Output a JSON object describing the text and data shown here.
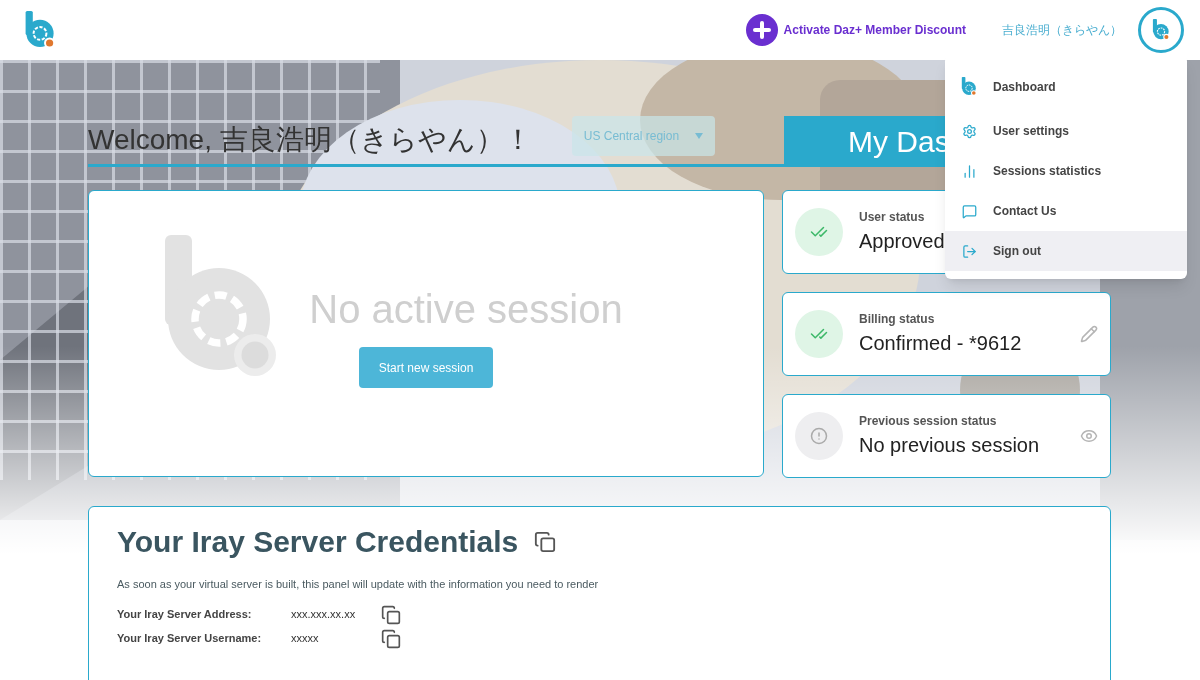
{
  "header": {
    "discount_link": "Activate Daz+ Member Discount",
    "user_name": "吉良浩明（きらやん）"
  },
  "welcome": "Welcome, 吉良浩明（きらやん）！",
  "region_select": {
    "value": "US Central region"
  },
  "dashboard_tab": "My Das",
  "session_panel": {
    "message": "No active session",
    "button": "Start new session"
  },
  "status_cards": [
    {
      "label": "User status",
      "value": "Approved",
      "kind": "ok",
      "editable": false,
      "viewable": false
    },
    {
      "label": "Billing status",
      "value": "Confirmed - *9612",
      "kind": "ok",
      "editable": true,
      "viewable": false
    },
    {
      "label": "Previous session status",
      "value": "No previous session",
      "kind": "info",
      "editable": false,
      "viewable": true
    }
  ],
  "user_menu": {
    "items": [
      {
        "label": "Dashboard",
        "kind": "logo",
        "selected": false
      },
      {
        "label": "User settings",
        "kind": "settings",
        "selected": false
      },
      {
        "label": "Sessions statistics",
        "kind": "stats",
        "selected": false
      },
      {
        "label": "Contact Us",
        "kind": "contact",
        "selected": false
      },
      {
        "label": "Sign out",
        "kind": "signout",
        "selected": true
      }
    ]
  },
  "credentials": {
    "title": "Your Iray Server Credentials",
    "note": "As soon as your virtual server is built, this panel will update with the information you need to render",
    "fields": [
      {
        "label": "Your Iray Server Address:",
        "value": "xxx.xxx.xx.xx"
      },
      {
        "label": "Your Iray Server Username:",
        "value": "xxxxx"
      }
    ]
  }
}
